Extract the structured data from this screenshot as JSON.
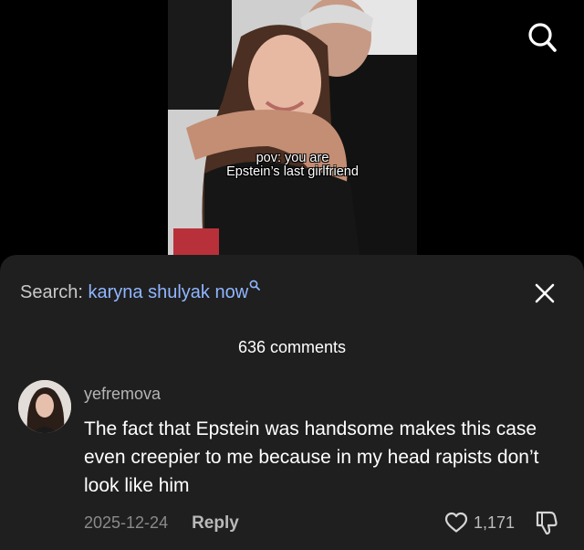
{
  "video": {
    "caption_line1": "pov: you are",
    "caption_line2": "Epstein’s last girlfriend"
  },
  "top_search_icon": "search-icon",
  "sheet": {
    "search_prefix": "Search:",
    "search_term": "karyna shulyak now",
    "search_icon": "search-icon",
    "close_icon": "close-icon",
    "comments_count": "636 comments"
  },
  "comment": {
    "username": "yefremova",
    "text": "The fact that Epstein was handsome makes this case even creepier to me because in my head rapists don’t look like him",
    "date": "2025-12-24",
    "reply_label": "Reply",
    "likes": "1,171",
    "like_icon": "heart-icon",
    "dislike_icon": "thumbs-down-icon"
  },
  "colors": {
    "sheet_bg": "#1f1f1f",
    "search_term": "#8fb6ff",
    "muted_text": "#8a8a8a"
  }
}
